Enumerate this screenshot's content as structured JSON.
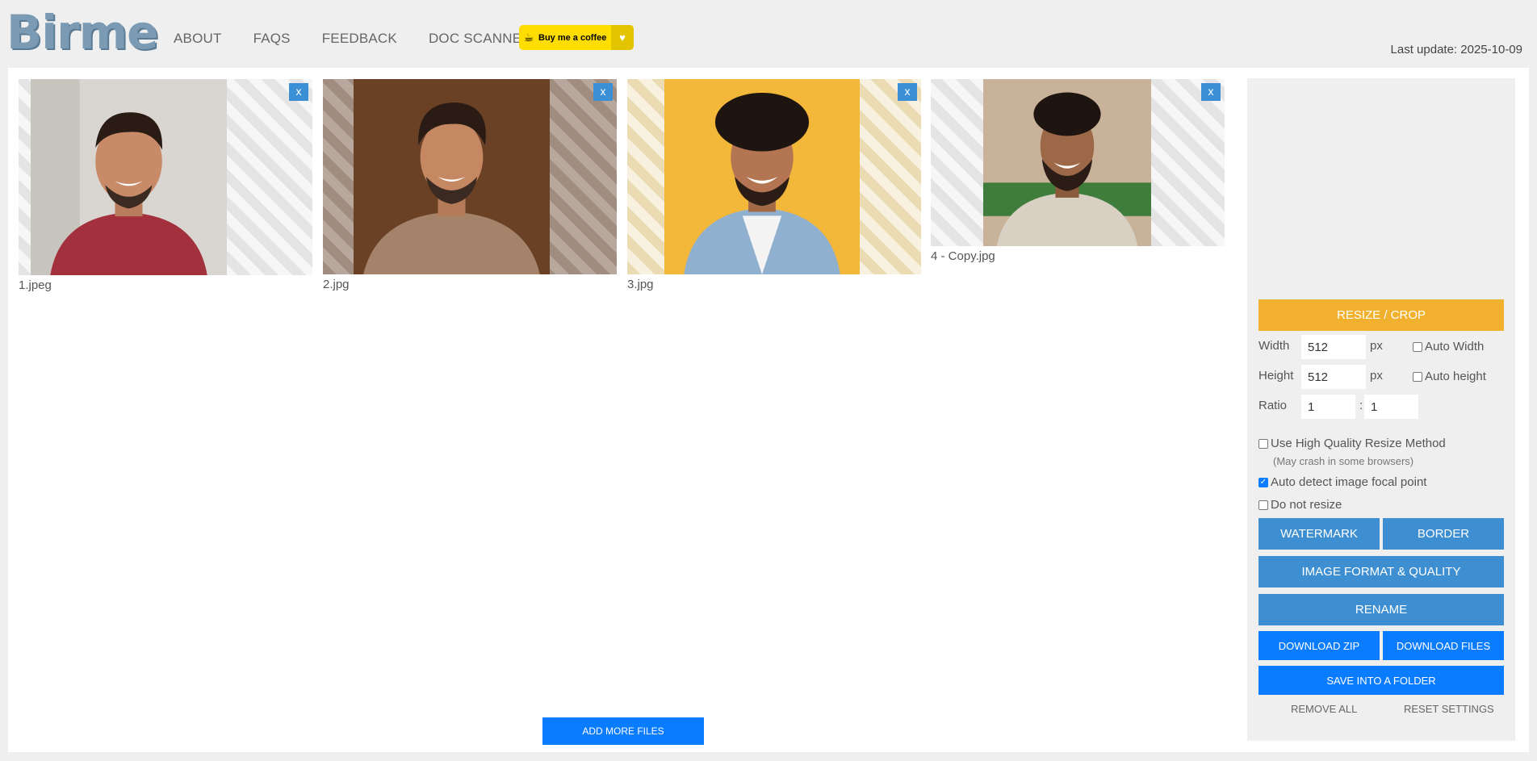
{
  "header": {
    "logo": "Birme",
    "nav": [
      "ABOUT",
      "FAQS",
      "FEEDBACK",
      "DOC SCANNER"
    ],
    "coffee_label": "Buy me a coffee",
    "last_update": "Last update: 2025-10-09"
  },
  "images": [
    {
      "name": "1.jpeg",
      "close": "x",
      "bg": "#d9d6d1",
      "shirt": "#a3313d"
    },
    {
      "name": "2.jpg",
      "close": "x",
      "bg": "#6b4126",
      "shirt": "#a5826a"
    },
    {
      "name": "3.jpg",
      "close": "x",
      "bg": "#f3b73a",
      "shirt": "#8fb0cf"
    },
    {
      "name": "4 - Copy.jpg",
      "close": "x",
      "bg": "#c9b29a",
      "shirt": "#d8d0c3"
    }
  ],
  "add_more": "ADD MORE FILES",
  "panel": {
    "resize_crop": "RESIZE / CROP",
    "width_label": "Width",
    "width_value": "512",
    "height_label": "Height",
    "height_value": "512",
    "px": "px",
    "auto_width": "Auto Width",
    "auto_height": "Auto height",
    "ratio_label": "Ratio",
    "ratio_a": "1",
    "ratio_b": "1",
    "ratio_sep": ":",
    "hq_label": "Use High Quality Resize Method",
    "hq_note": "(May crash in some browsers)",
    "focal_label": "Auto detect image focal point",
    "no_resize_label": "Do not resize",
    "watermark": "WATERMARK",
    "border": "BORDER",
    "format_quality": "IMAGE FORMAT & QUALITY",
    "rename": "RENAME",
    "download_zip": "DOWNLOAD ZIP",
    "download_files": "DOWNLOAD FILES",
    "save_folder": "SAVE INTO A FOLDER",
    "remove_all": "REMOVE ALL",
    "reset_settings": "RESET SETTINGS"
  },
  "colors": {
    "accent_orange": "#f1b02e",
    "accent_blue": "#3e8fd2",
    "bright_blue": "#0a7cff"
  }
}
